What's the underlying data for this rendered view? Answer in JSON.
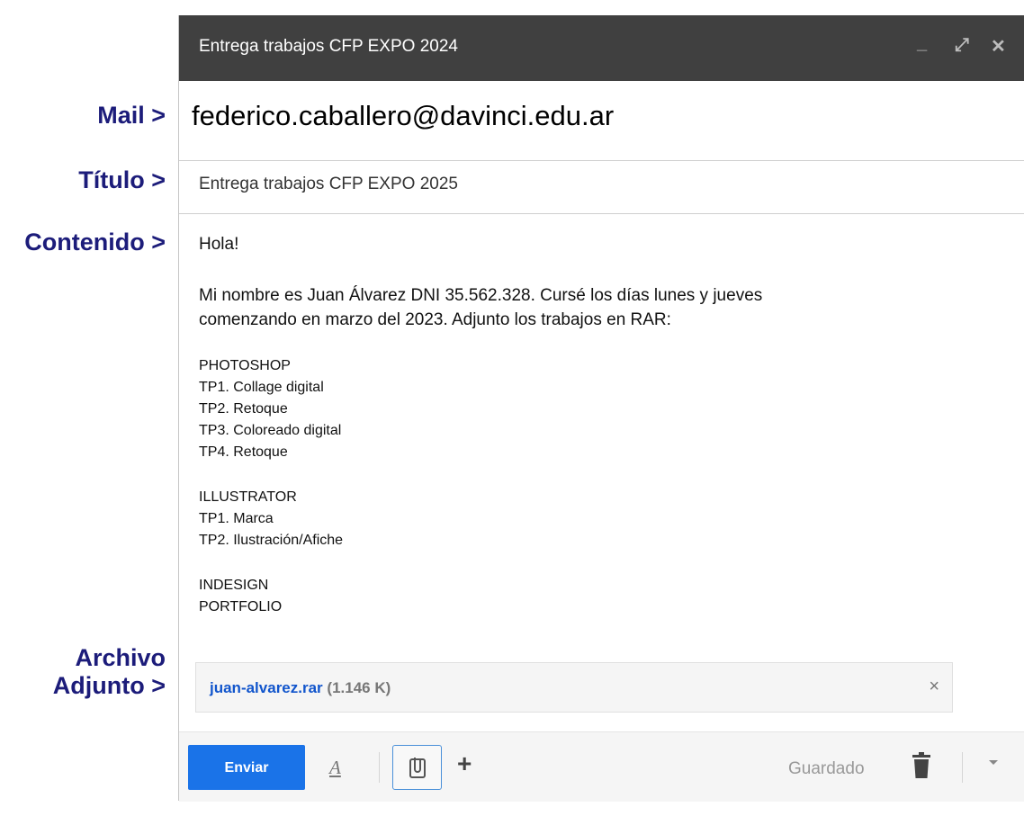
{
  "side_labels": {
    "mail": "Mail >",
    "titulo": "Título  >",
    "contenido": "Contenido  >",
    "archivo_line1": "Archivo",
    "archivo_line2": "Adjunto >"
  },
  "window": {
    "title": "Entrega trabajos CFP EXPO 2024",
    "controls": {
      "minimize": "_",
      "maximize": "⤢",
      "close": "✕"
    }
  },
  "to": "federico.caballero@davinci.edu.ar",
  "subject": "Entrega trabajos CFP EXPO 2025",
  "body": {
    "greeting": "Hola!",
    "intro_line1": "Mi nombre es Juan Álvarez DNI 35.562.328. Cursé los días lunes y jueves",
    "intro_line2": "comenzando en marzo del 2023. Adjunto los trabajos en RAR:",
    "photoshop": [
      "PHOTOSHOP",
      "TP1. Collage digital",
      "TP2. Retoque",
      "TP3. Coloreado digital",
      "TP4. Retoque"
    ],
    "illustrator": [
      "ILLUSTRATOR",
      "TP1. Marca",
      "TP2. Ilustración/Afiche"
    ],
    "indesign": [
      "INDESIGN",
      "PORTFOLIO"
    ]
  },
  "attachment": {
    "name": "juan-alvarez.rar",
    "size": "(1.146 K)",
    "remove": "×"
  },
  "toolbar": {
    "send_label": "Enviar",
    "format_icon": "A",
    "plus": "+",
    "saved_label": "Guardado",
    "icons": [
      "format-text-icon",
      "paperclip-icon",
      "plus-icon",
      "trash-icon",
      "dropdown-arrow-icon"
    ]
  },
  "colors": {
    "label_navy": "#1c1c7a",
    "titlebar": "#404040",
    "send_blue": "#1a73e8",
    "link_blue": "#1155cc"
  }
}
